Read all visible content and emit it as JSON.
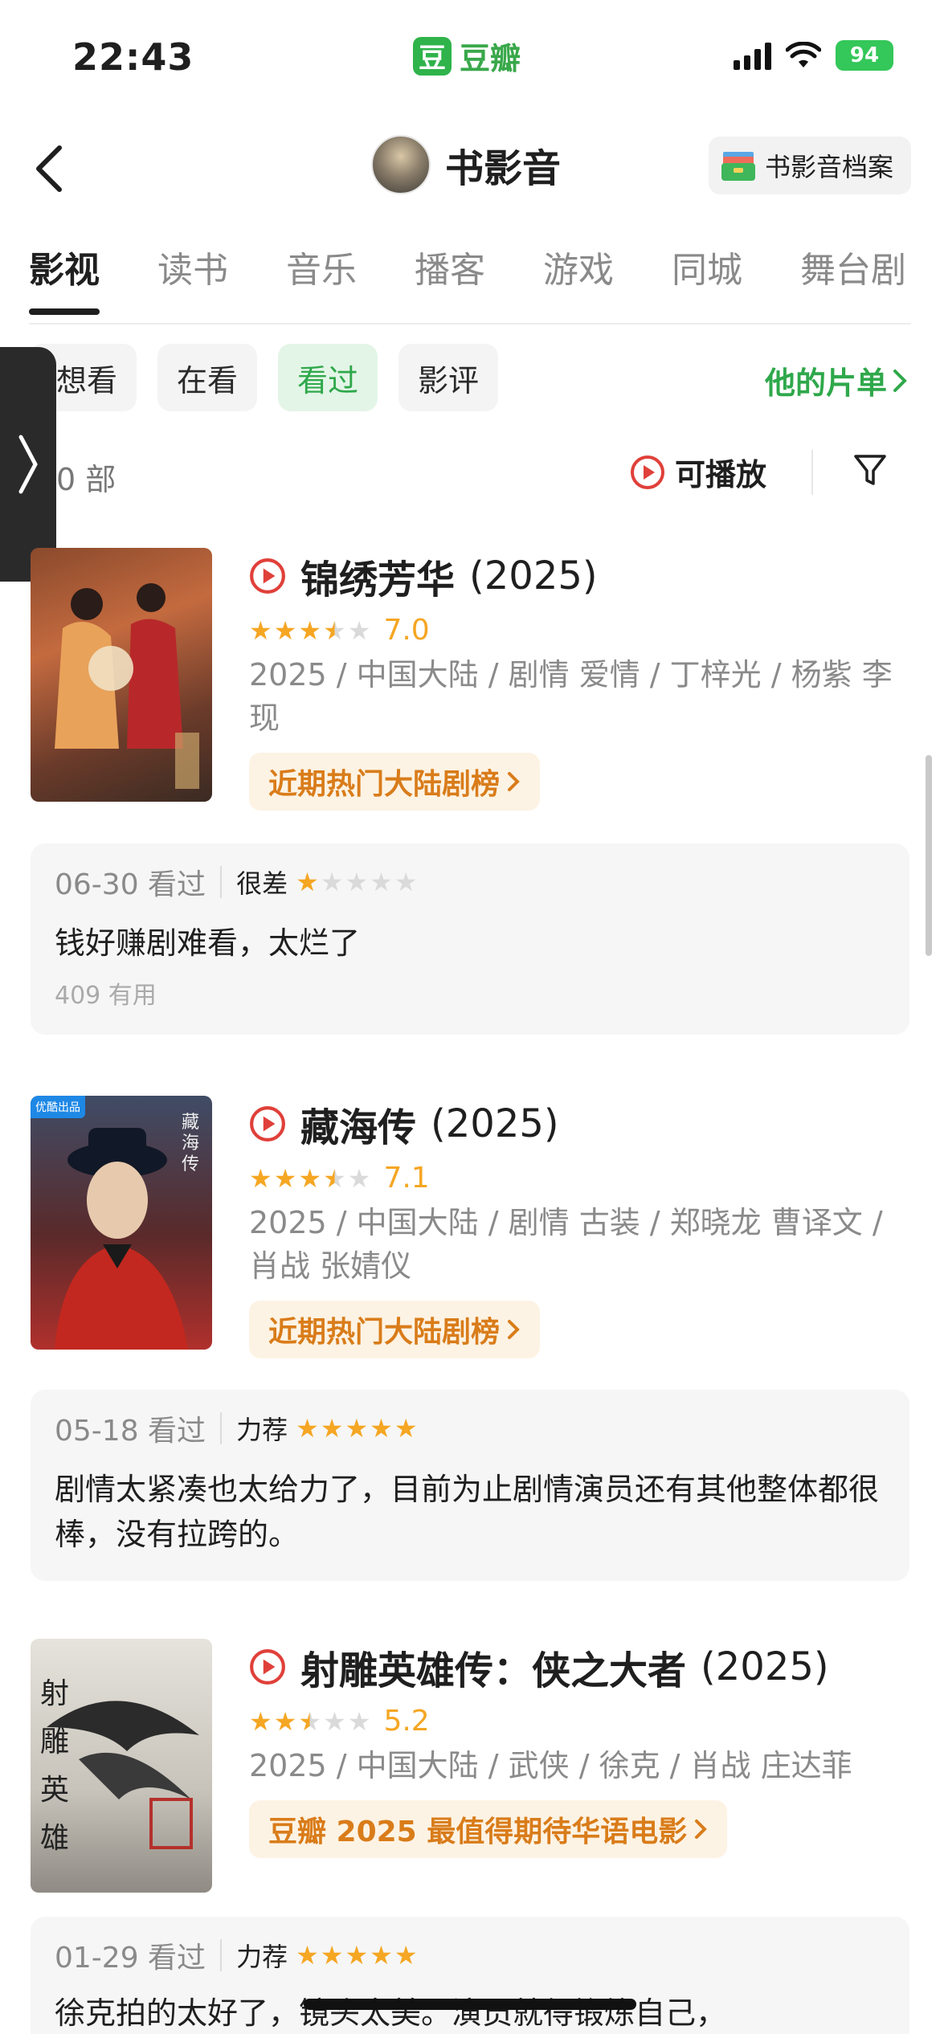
{
  "status_bar": {
    "time": "22:43",
    "app_name": "豆瓣",
    "app_logo_char": "豆",
    "battery": "94"
  },
  "nav": {
    "title": "书影音",
    "archive_label": "书影音档案"
  },
  "tabs": [
    "影视",
    "读书",
    "音乐",
    "播客",
    "游戏",
    "同城",
    "舞台剧"
  ],
  "filters": [
    "想看",
    "在看",
    "看过",
    "影评"
  ],
  "active_filter": "看过",
  "playlist_link": "他的片单",
  "count_text": "0 部",
  "playable_label": "可播放",
  "items": [
    {
      "title": "锦绣芳华",
      "year": "(2025)",
      "rating": 7.0,
      "score": "7.0",
      "stars": 3.5,
      "meta": "2025 / 中国大陆 / 剧情 爱情 / 丁梓光 / 杨紫 李现",
      "rank_label": "近期热门大陆剧榜",
      "review": {
        "date": "06-30 看过",
        "verdict": "很差",
        "stars": 1,
        "text": "钱好赚剧难看，太烂了",
        "useful": "409 有用"
      }
    },
    {
      "title": "藏海传",
      "year": "(2025)",
      "rating": 7.1,
      "score": "7.1",
      "stars": 3.5,
      "meta": "2025 / 中国大陆 / 剧情 古装 / 郑晓龙 曹译文 / 肖战 张婧仪",
      "rank_label": "近期热门大陆剧榜",
      "poster_tag": "优酷出品",
      "review": {
        "date": "05-18 看过",
        "verdict": "力荐",
        "stars": 5,
        "text": "剧情太紧凑也太给力了，目前为止剧情演员还有其他整体都很棒，没有拉跨的。"
      }
    },
    {
      "title": "射雕英雄传：侠之大者",
      "year": "(2025)",
      "rating": 5.2,
      "score": "5.2",
      "stars": 2.5,
      "meta": "2025 / 中国大陆 / 武侠 / 徐克 / 肖战 庄达菲",
      "rank_label": "豆瓣 2025 最值得期待华语电影",
      "review": {
        "date": "01-29 看过",
        "verdict": "力荐",
        "stars": 5,
        "text": "徐克拍的太好了，镜头太美。演员就得锻炼自己，"
      }
    }
  ]
}
